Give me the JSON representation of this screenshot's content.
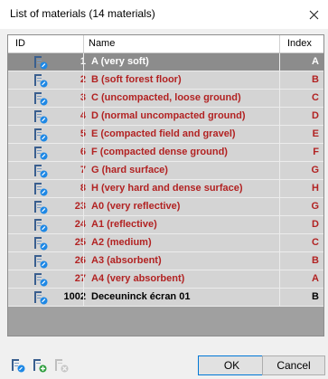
{
  "window": {
    "title": "List of materials (14 materials)"
  },
  "table": {
    "columns": [
      "ID",
      "Name",
      "Index"
    ],
    "rows": [
      {
        "id": "1",
        "name": "A (very soft)",
        "index": "A"
      },
      {
        "id": "2",
        "name": "B (soft forest floor)",
        "index": "B"
      },
      {
        "id": "3",
        "name": "C (uncompacted, loose ground)",
        "index": "C"
      },
      {
        "id": "4",
        "name": "D (normal uncompacted ground)",
        "index": "D"
      },
      {
        "id": "5",
        "name": "E (compacted field and gravel)",
        "index": "E"
      },
      {
        "id": "6",
        "name": "F (compacted dense ground)",
        "index": "F"
      },
      {
        "id": "7",
        "name": "G (hard surface)",
        "index": "G"
      },
      {
        "id": "8",
        "name": "H (very hard and dense surface)",
        "index": "H"
      },
      {
        "id": "23",
        "name": "A0 (very reflective)",
        "index": "G"
      },
      {
        "id": "24",
        "name": "A1 (reflective)",
        "index": "D"
      },
      {
        "id": "25",
        "name": "A2 (medium)",
        "index": "C"
      },
      {
        "id": "26",
        "name": "A3 (absorbent)",
        "index": "B"
      },
      {
        "id": "27",
        "name": "A4 (very absorbent)",
        "index": "A"
      },
      {
        "id": "1002",
        "name": "Deceuninck écran 01",
        "index": "B"
      }
    ]
  },
  "footer": {
    "ok_label": "OK",
    "cancel_label": "Cancel"
  },
  "colors": {
    "library_text": "#b22222",
    "selected_row": "#8c8c8c",
    "row_background": "#d4d4d4",
    "default_button_border": "#0078d7"
  },
  "icons": {
    "row": "material-icon",
    "footer": [
      "edit-material-icon",
      "add-material-icon",
      "delete-material-icon"
    ],
    "close": "close-icon"
  }
}
